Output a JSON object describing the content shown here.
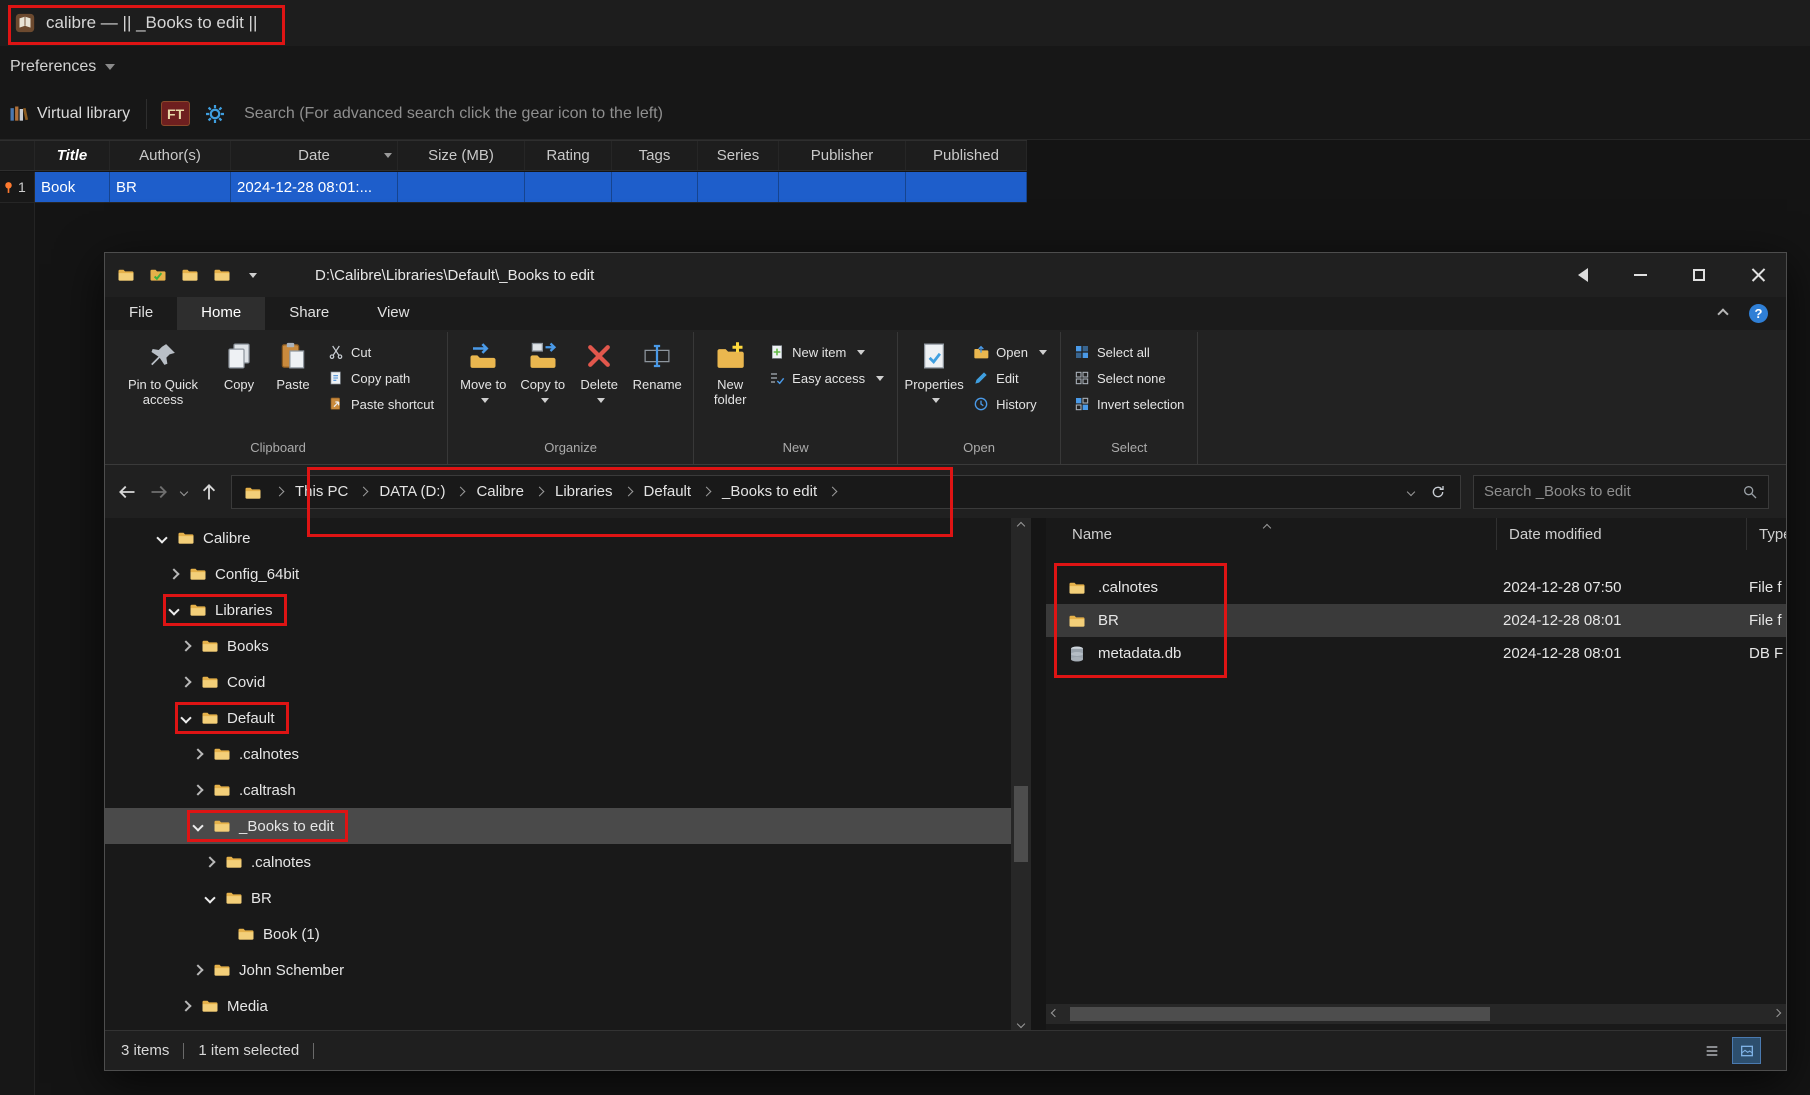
{
  "calibre": {
    "window_title": "calibre — || _Books to edit ||",
    "preferences_label": "Preferences",
    "virtual_library_label": "Virtual library",
    "ft_label": "FT",
    "search_placeholder": "Search (For advanced search click the gear icon to the left)",
    "columns": [
      "Title",
      "Author(s)",
      "Date",
      "Size (MB)",
      "Rating",
      "Tags",
      "Series",
      "Publisher",
      "Published"
    ],
    "book_row": {
      "number": "1",
      "title": "Book",
      "authors": "BR",
      "date": "2024-12-28 08:01:..."
    }
  },
  "explorer": {
    "window_title": "D:\\Calibre\\Libraries\\Default\\_Books to edit",
    "menu_tabs": [
      "File",
      "Home",
      "Share",
      "View"
    ],
    "active_tab": "Home",
    "ribbon_groups": [
      {
        "label": "Clipboard",
        "big": [
          {
            "label": "Pin to Quick access",
            "icon": "pin"
          },
          {
            "label": "Copy",
            "icon": "copy"
          },
          {
            "label": "Paste",
            "icon": "paste"
          }
        ],
        "small": [
          {
            "label": "Cut",
            "icon": "cut"
          },
          {
            "label": "Copy path",
            "icon": "copypath"
          },
          {
            "label": "Paste shortcut",
            "icon": "pasteshort"
          }
        ]
      },
      {
        "label": "Organize",
        "big": [
          {
            "label": "Move to",
            "icon": "moveto",
            "dropdown": true
          },
          {
            "label": "Copy to",
            "icon": "copyto",
            "dropdown": true
          },
          {
            "label": "Delete",
            "icon": "delete",
            "dropdown": true
          },
          {
            "label": "Rename",
            "icon": "rename"
          }
        ],
        "small": []
      },
      {
        "label": "New",
        "big": [
          {
            "label": "New folder",
            "icon": "newfolder"
          }
        ],
        "small": [
          {
            "label": "New item",
            "icon": "newitem",
            "dropdown": true
          },
          {
            "label": "Easy access",
            "icon": "easyaccess",
            "dropdown": true
          }
        ]
      },
      {
        "label": "Open",
        "big": [
          {
            "label": "Properties",
            "icon": "properties",
            "dropdown": true
          }
        ],
        "small": [
          {
            "label": "Open",
            "icon": "open",
            "dropdown": true
          },
          {
            "label": "Edit",
            "icon": "edit"
          },
          {
            "label": "History",
            "icon": "history"
          }
        ]
      },
      {
        "label": "Select",
        "big": [],
        "small": [
          {
            "label": "Select all",
            "icon": "selectall"
          },
          {
            "label": "Select none",
            "icon": "selectnone"
          },
          {
            "label": "Invert selection",
            "icon": "invert"
          }
        ]
      }
    ],
    "breadcrumb": [
      "This PC",
      "DATA (D:)",
      "Calibre",
      "Libraries",
      "Default",
      "_Books to edit"
    ],
    "search_placeholder": "Search _Books to edit",
    "tree": [
      {
        "label": "Calibre",
        "level": 0,
        "state": "expanded"
      },
      {
        "label": "Config_64bit",
        "level": 1,
        "state": "collapsed"
      },
      {
        "label": "Libraries",
        "level": 1,
        "state": "expanded",
        "annotated": true
      },
      {
        "label": "Books",
        "level": 2,
        "state": "collapsed"
      },
      {
        "label": "Covid",
        "level": 2,
        "state": "collapsed"
      },
      {
        "label": "Default",
        "level": 2,
        "state": "expanded",
        "annotated": true
      },
      {
        "label": ".calnotes",
        "level": 3,
        "state": "collapsed"
      },
      {
        "label": ".caltrash",
        "level": 3,
        "state": "collapsed"
      },
      {
        "label": "_Books to edit",
        "level": 3,
        "state": "expanded",
        "selected": true,
        "annotated": true
      },
      {
        "label": ".calnotes",
        "level": 4,
        "state": "collapsed"
      },
      {
        "label": "BR",
        "level": 4,
        "state": "expanded"
      },
      {
        "label": "Book (1)",
        "level": 5,
        "state": "leaf"
      },
      {
        "label": "John Schember",
        "level": 3,
        "state": "collapsed"
      },
      {
        "label": "Media",
        "level": 2,
        "state": "collapsed"
      }
    ],
    "files": {
      "columns": [
        "Name",
        "Date modified",
        "Type"
      ],
      "rows": [
        {
          "name": ".calnotes",
          "date_modified": "2024-12-28 07:50",
          "type": "File f",
          "icon": "folder"
        },
        {
          "name": "BR",
          "date_modified": "2024-12-28 08:01",
          "type": "File f",
          "icon": "folder",
          "selected": true
        },
        {
          "name": "metadata.db",
          "date_modified": "2024-12-28 08:01",
          "type": "DB F",
          "icon": "database"
        }
      ]
    },
    "status_bar": {
      "items_count": "3 items",
      "selection": "1 item selected"
    }
  }
}
